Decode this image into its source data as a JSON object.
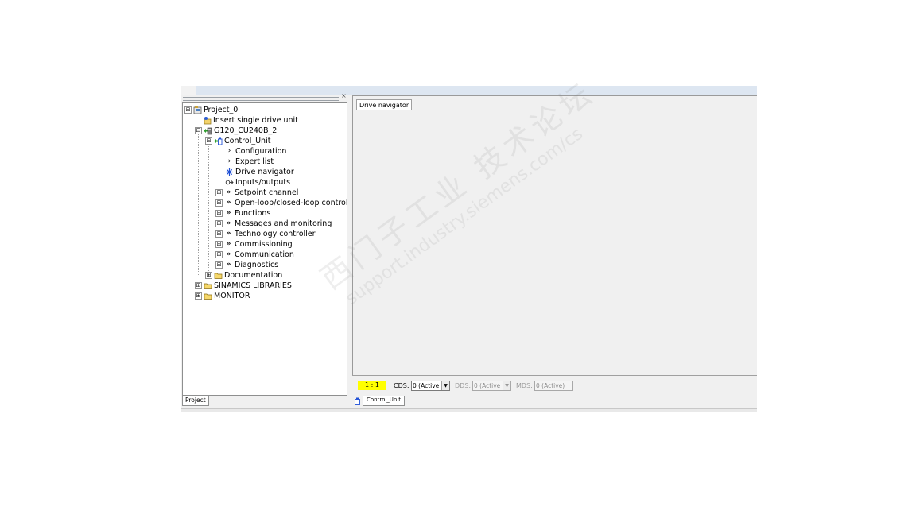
{
  "project_panel": {
    "tab_label": "Project",
    "close_glyph": "×",
    "tree": [
      {
        "label": "Project_0",
        "icon": "project-icon",
        "expander": "⊟"
      },
      {
        "label": "Insert single drive unit",
        "icon": "insert-drive-icon"
      },
      {
        "label": "G120_CU240B_2",
        "icon": "drive-unit-icon",
        "expander": "⊟"
      },
      {
        "label": "Control_Unit",
        "icon": "control-unit-icon",
        "expander": "⊟"
      },
      {
        "label": "Configuration",
        "icon": "chevron-right-icon"
      },
      {
        "label": "Expert list",
        "icon": "chevron-right-icon"
      },
      {
        "label": "Drive navigator",
        "icon": "navigator-icon"
      },
      {
        "label": "Inputs/outputs",
        "icon": "io-icon"
      },
      {
        "label": "Setpoint channel",
        "icon": "double-chevron-icon",
        "expander": "⊞"
      },
      {
        "label": "Open-loop/closed-loop control",
        "icon": "double-chevron-icon",
        "expander": "⊞"
      },
      {
        "label": "Functions",
        "icon": "double-chevron-icon",
        "expander": "⊞"
      },
      {
        "label": "Messages and monitoring",
        "icon": "double-chevron-icon",
        "expander": "⊞"
      },
      {
        "label": "Technology controller",
        "icon": "double-chevron-icon",
        "expander": "⊞"
      },
      {
        "label": "Commissioning",
        "icon": "double-chevron-icon",
        "expander": "⊞"
      },
      {
        "label": "Communication",
        "icon": "double-chevron-icon",
        "expander": "⊞"
      },
      {
        "label": "Diagnostics",
        "icon": "double-chevron-icon",
        "expander": "⊞"
      },
      {
        "label": "Documentation",
        "icon": "folder-icon",
        "expander": "⊞"
      },
      {
        "label": "SINAMICS LIBRARIES",
        "icon": "folder-icon",
        "expander": "⊞"
      },
      {
        "label": "MONITOR",
        "icon": "folder-icon",
        "expander": "⊞"
      }
    ]
  },
  "workspace": {
    "tab_label": "Drive navigator"
  },
  "statusbar": {
    "zoom": "1 : 1",
    "cds_label": "CDS:",
    "cds_value": "0 (Active",
    "dds_label": "DDS:",
    "dds_value": "0 (Active",
    "mds_label": "MDS:",
    "mds_value": "0 (Active)"
  },
  "bottom_tabs": {
    "control_unit": "Control_Unit"
  },
  "watermark": {
    "chinese": "西门子工业 技术论坛",
    "url": "support.industry.siemens.com/cs"
  },
  "colors": {
    "zoom_highlight": "#ffff00",
    "panel_bg": "#f0f0f0",
    "top_strip": "#dde6f1",
    "drive_green": "#2e9e2e",
    "navigator_blue": "#1f4fd6"
  }
}
